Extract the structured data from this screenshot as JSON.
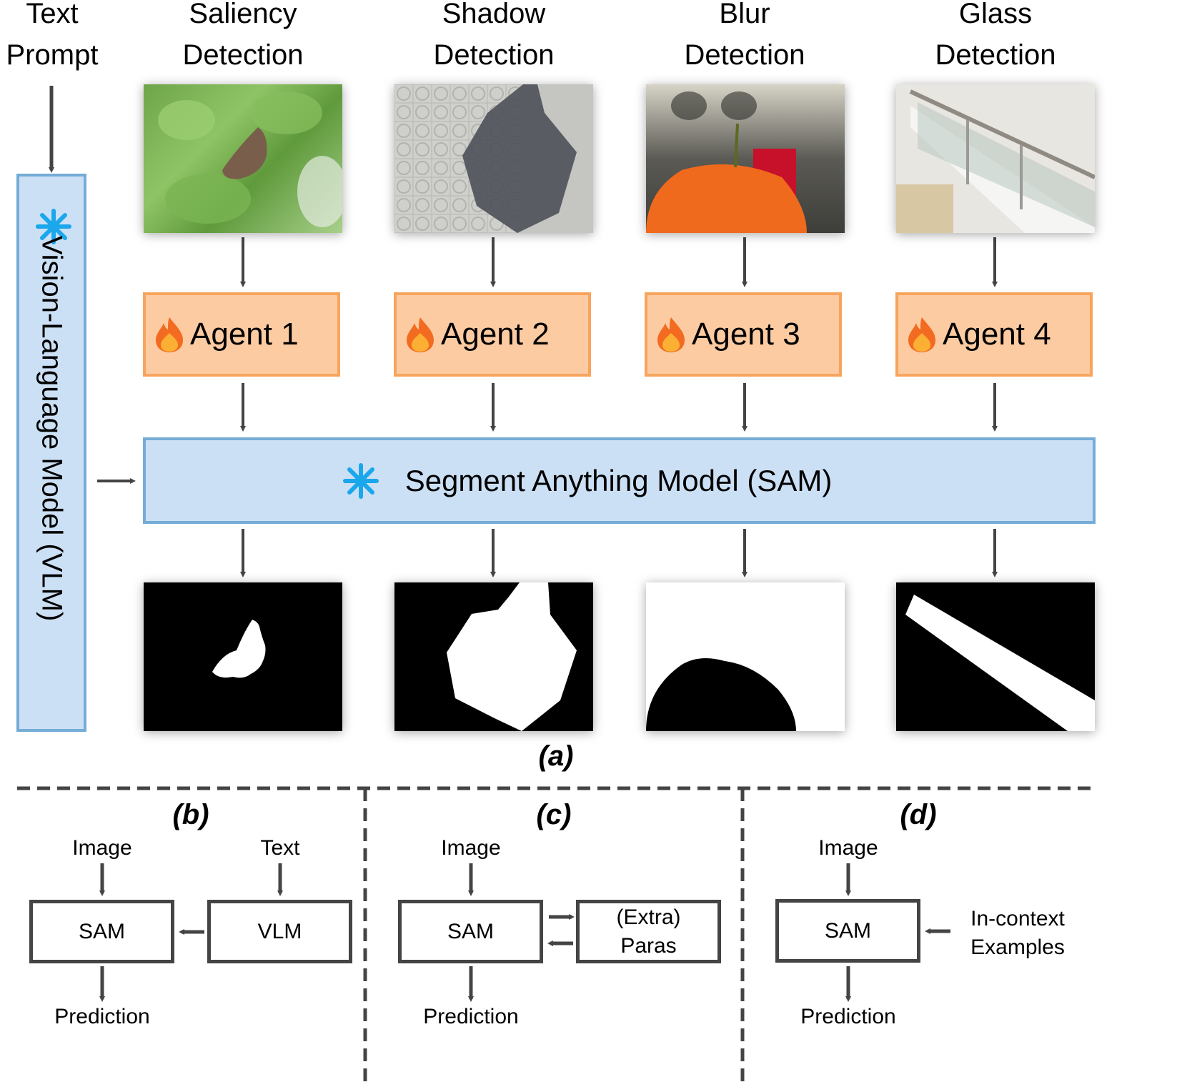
{
  "headers": {
    "text_prompt": [
      "Text",
      "Prompt"
    ],
    "columns": [
      {
        "line1": "Saliency",
        "line2": "Detection"
      },
      {
        "line1": "Shadow",
        "line2": "Detection"
      },
      {
        "line1": "Blur",
        "line2": "Detection"
      },
      {
        "line1": "Glass",
        "line2": "Detection"
      }
    ]
  },
  "agents": [
    {
      "label": "Agent 1",
      "icon": "flame-icon"
    },
    {
      "label": "Agent 2",
      "icon": "flame-icon"
    },
    {
      "label": "Agent 3",
      "icon": "flame-icon"
    },
    {
      "label": "Agent 4",
      "icon": "flame-icon"
    }
  ],
  "sam": {
    "label": "Segment Anything Model (SAM)",
    "icon": "snowflake-icon"
  },
  "vlm": {
    "label": "Vision-Language Model (VLM)",
    "icon": "snowflake-icon"
  },
  "photos": [
    {
      "subject": "butterfly on green leaves"
    },
    {
      "subject": "shadow on paved tiles"
    },
    {
      "subject": "orange with blurred background"
    },
    {
      "subject": "staircase with glass railing"
    }
  ],
  "masks": [
    {
      "subject": "butterfly mask"
    },
    {
      "subject": "shadow mask"
    },
    {
      "subject": "blur mask"
    },
    {
      "subject": "glass mask"
    }
  ],
  "captions": {
    "a": "(a)",
    "b": "(b)",
    "c": "(c)",
    "d": "(d)"
  },
  "panel_b": {
    "input1": "Image",
    "input2": "Text",
    "box1": "SAM",
    "box2": "VLM",
    "output": "Prediction"
  },
  "panel_c": {
    "input1": "Image",
    "box1": "SAM",
    "box2_line1": "(Extra)",
    "box2_line2": "Paras",
    "output": "Prediction"
  },
  "panel_d": {
    "input1": "Image",
    "box1": "SAM",
    "side_line1": "In-context",
    "side_line2": "Examples",
    "output": "Prediction"
  },
  "colors": {
    "agent_fill": "#fdcba2",
    "agent_border": "#f7a45d",
    "model_fill": "#cce0f5",
    "model_border": "#74acd6",
    "snowflake": "#1aa7ec",
    "arrow": "#444444"
  }
}
